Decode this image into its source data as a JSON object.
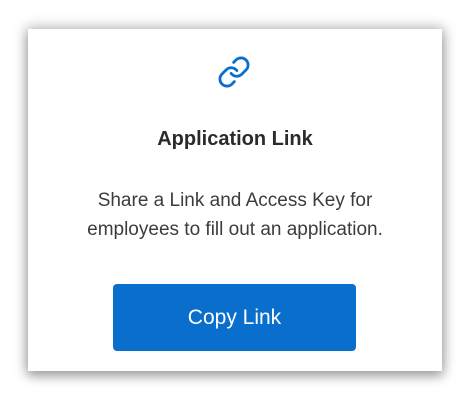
{
  "card": {
    "icon": "link-icon",
    "title": "Application Link",
    "description": "Share a Link and Access Key for employees to fill out an application.",
    "button_label": "Copy Link"
  },
  "colors": {
    "accent": "#0a6fcc",
    "title_text": "#2b2b2b",
    "body_text": "#3c3c3c"
  }
}
